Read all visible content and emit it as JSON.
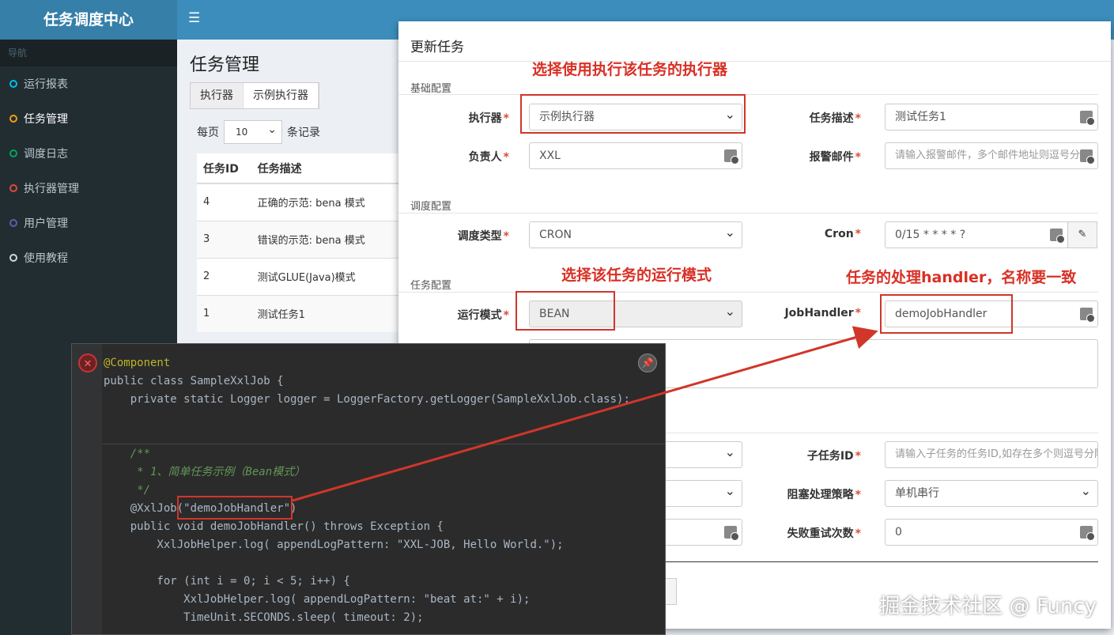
{
  "app": {
    "title": "任务调度中心"
  },
  "sidebar": {
    "header": "导航",
    "items": [
      {
        "label": "运行报表",
        "color": "#00c0ef"
      },
      {
        "label": "任务管理",
        "color": "#f39c12"
      },
      {
        "label": "调度日志",
        "color": "#00a65a"
      },
      {
        "label": "执行器管理",
        "color": "#dd4b39"
      },
      {
        "label": "用户管理",
        "color": "#605ca8"
      },
      {
        "label": "使用教程",
        "color": "#d2d6de"
      }
    ]
  },
  "page": {
    "title": "任务管理",
    "filter": {
      "label": "执行器",
      "value": "示例执行器"
    },
    "per_page": {
      "prefix": "每页",
      "value": "10",
      "suffix": "条记录"
    },
    "table": {
      "headers": [
        "任务ID",
        "任务描述"
      ],
      "rows": [
        [
          "4",
          "正确的示范: bena 模式"
        ],
        [
          "3",
          "错误的示范: bena 模式"
        ],
        [
          "2",
          "测试GLUE(Java)模式"
        ],
        [
          "1",
          "测试任务1"
        ]
      ]
    }
  },
  "modal": {
    "title": "更新任务",
    "sections": {
      "basic": "基础配置",
      "schedule": "调度配置",
      "job": "任务配置"
    },
    "fields": {
      "executor": {
        "label": "执行器",
        "value": "示例执行器"
      },
      "job_desc": {
        "label": "任务描述",
        "value": "测试任务1"
      },
      "author": {
        "label": "负责人",
        "value": "XXL"
      },
      "alarm_email": {
        "label": "报警邮件",
        "placeholder": "请输入报警邮件，多个邮件地址则逗号分隔"
      },
      "schedule_type": {
        "label": "调度类型",
        "value": "CRON"
      },
      "cron": {
        "label": "Cron",
        "value": "0/15 * * * * ?"
      },
      "glue_type": {
        "label": "运行模式",
        "value": "BEAN"
      },
      "job_handler": {
        "label": "JobHandler",
        "value": "demoJobHandler"
      },
      "child_job": {
        "label": "子任务ID",
        "placeholder": "请输入子任务的任务ID,如存在多个则逗号分隔"
      },
      "block_strategy": {
        "label": "阻塞处理策略",
        "value": "单机串行"
      },
      "fail_retry": {
        "label": "失败重试次数",
        "value": "0"
      }
    }
  },
  "annotations": {
    "executor_note": "选择使用执行该任务的执行器",
    "mode_note": "选择该任务的运行模式",
    "handler_note": "任务的处理handler，名称要一致"
  },
  "code": {
    "lines": [
      "@Component",
      "public class SampleXxlJob {",
      "    private static Logger logger = LoggerFactory.getLogger(SampleXxlJob.class);",
      "    /**",
      "     * 1、简单任务示例（Bean模式）",
      "     */",
      "    @XxlJob(\"demoJobHandler\")",
      "    public void demoJobHandler() throws Exception {",
      "        XxlJobHelper.log( appendLogPattern: \"XXL-JOB, Hello World.\");",
      "        for (int i = 0; i < 5; i++) {",
      "            XxlJobHelper.log( appendLogPattern: \"beat at:\" + i);",
      "            TimeUnit.SECONDS.sleep( timeout: 2);"
    ]
  },
  "watermark": "掘金技术社区 @ Funcy"
}
